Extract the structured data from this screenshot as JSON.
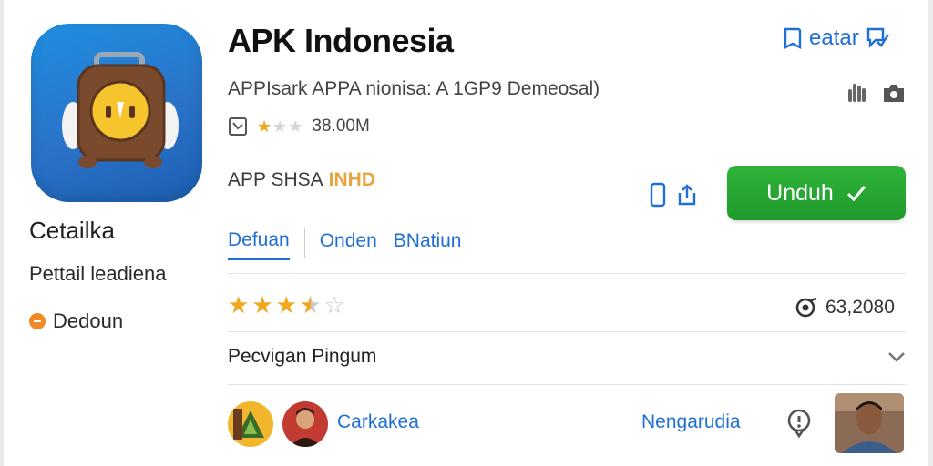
{
  "app": {
    "title": "APK Indonesia",
    "subtitle": "APPIsark APPA nionisa: A 1GP9 Demeosal)",
    "size": "38.00M",
    "developer_label": "APP SHSA",
    "developer_badge": "INHD"
  },
  "header": {
    "link_label": "eatar"
  },
  "left_panel": {
    "title": "Cetailka",
    "subtitle": "Pettail leadiena",
    "status": "Dedoun"
  },
  "install_button": {
    "label": "Unduh"
  },
  "tabs": [
    {
      "label": "Defuan",
      "active": true
    },
    {
      "label": "Onden"
    },
    {
      "label": "BNatiun"
    }
  ],
  "rating": {
    "stars": 3.5,
    "max": 5,
    "count": "63,2080"
  },
  "meta": {
    "stars_filled": 1,
    "stars_max": 3
  },
  "section": {
    "title": "Pecvigan Pingum"
  },
  "user": {
    "name": "Carkakea",
    "action": "Nengarudia"
  },
  "colors": {
    "accent": "#1f6fd6",
    "install": "#22a22f",
    "star": "#f2a81d",
    "icon_bg": "#2a73c9"
  },
  "icons": [
    "bookmark-icon",
    "feedback-icon",
    "hand-icon",
    "camera-icon",
    "info-icon",
    "phone-icon",
    "share-icon",
    "check-icon",
    "chevron-down-icon",
    "view-count-icon",
    "help-icon"
  ]
}
